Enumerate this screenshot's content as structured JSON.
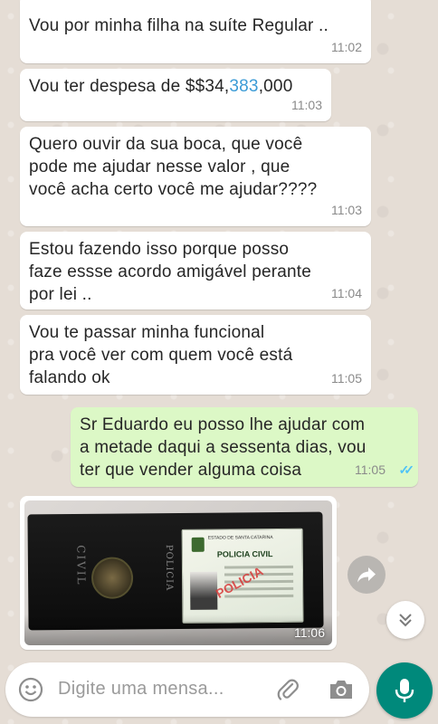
{
  "messages": [
    {
      "text": "Vou por minha filha na suíte Regular ..",
      "time": "11:02"
    },
    {
      "text_before": "Vou ter despesa de $$34,",
      "text_link": "383",
      "text_after": ",000",
      "time": "11:03"
    },
    {
      "text": "Quero ouvir  da sua boca, que você\npode me ajudar nesse valor , que\nvocê acha certo você me ajudar????",
      "time": "11:03"
    },
    {
      "text": "Estou fazendo isso porque posso\nfaze essse acordo amigável perante\npor lei ..",
      "time": "11:04"
    },
    {
      "text": "Vou te passar minha funcional\npra você ver com quem você está\nfalando ok",
      "time": "11:05"
    },
    {
      "text": "Sr Eduardo eu posso lhe ajudar com\na metade daqui a sessenta dias, vou\nter que vender alguma coisa",
      "time": "11:05",
      "outgoing": true,
      "ticks": "✓✓"
    }
  ],
  "photo_message": {
    "time": "11:06",
    "wallet_text_civil": "CIVIL",
    "wallet_text_policia": "POLICIA",
    "id_header": "ESTADO DE SANTA CATARINA",
    "id_title": "POLICIA CIVIL",
    "id_stamp": "POLICIA"
  },
  "composer": {
    "placeholder": "Digite uma mensa..."
  },
  "colors": {
    "incoming": "#ffffff",
    "outgoing": "#dcf8c6",
    "accent": "#00897b",
    "link": "#3b9bd6",
    "ticks": "#4fc3f7"
  },
  "icons": {
    "emoji": "emoji-icon",
    "attach": "paperclip-icon",
    "camera": "camera-icon",
    "mic": "mic-icon",
    "forward": "forward-icon",
    "scroll": "double-chevron-down-icon"
  }
}
